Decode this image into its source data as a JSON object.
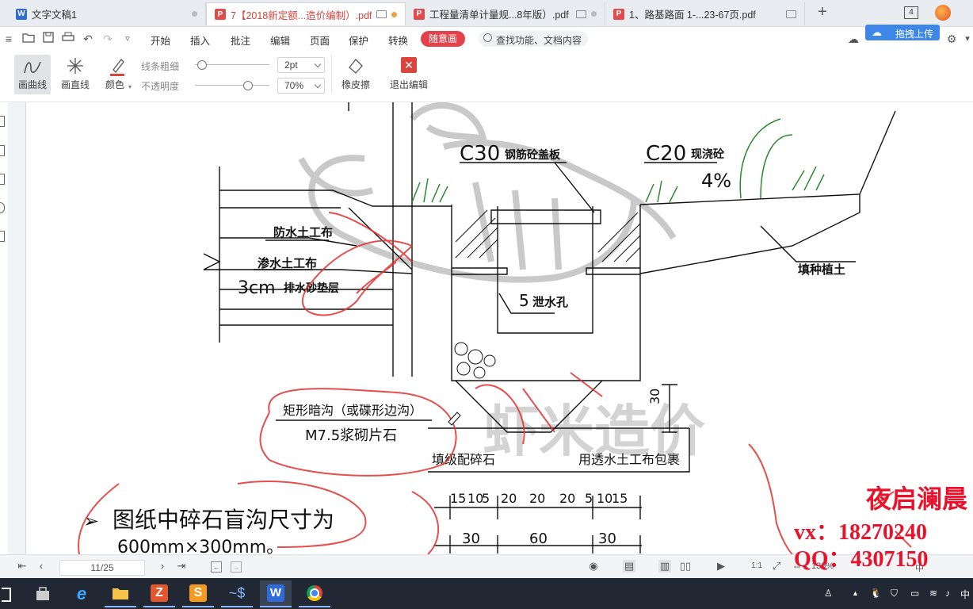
{
  "tabs": [
    {
      "label": "文字文稿1",
      "icon": "word-doc-icon",
      "icon_color": "#2e6bd9",
      "active": false
    },
    {
      "label": "7【2018新定额...造价编制）.pdf",
      "icon": "pdf-icon",
      "icon_color": "#e24b4b",
      "active": true
    },
    {
      "label": "工程量清单计量规...8年版）.pdf",
      "icon": "pdf-icon",
      "icon_color": "#e24b4b",
      "active": false
    },
    {
      "label": "1、路基路面   1-...23-67页.pdf",
      "icon": "pdf-icon",
      "icon_color": "#e24b4b",
      "active": false
    }
  ],
  "window": {
    "count": "4"
  },
  "menubar": {
    "items": [
      "开始",
      "插入",
      "批注",
      "编辑",
      "页面",
      "保护",
      "转换"
    ],
    "active_item": "随意画",
    "search_placeholder": "查找功能、文档内容",
    "cloud_button": "拖拽上传",
    "accent_color": "#e2424b"
  },
  "drawbar": {
    "curve_label": "画曲线",
    "line_label": "画直线",
    "color_label": "颜色",
    "stroke_width_label": "线条粗细",
    "opacity_label": "不透明度",
    "stroke_width_value": "2pt",
    "opacity_value": "70%",
    "opacity_level": 0.7,
    "eraser_label": "橡皮擦",
    "exit_label": "退出编辑"
  },
  "document": {
    "label_c30": "C30",
    "label_c30_sub": "钢筋砼盖板",
    "label_c20": "C20",
    "label_c20_sub": "现浇砼",
    "label_slope": "4%",
    "label_geotextile_waterproof": "防水土工布",
    "label_geotextile_permeable": "渗水土工布",
    "label_sand_layer": "3cm",
    "label_sand_layer_sub": "排水砂垫层",
    "label_drain_hole": "5",
    "label_drain_hole_sub": "泄水孔",
    "label_planting_soil": "填种植土",
    "label_ditch_line1": "矩形暗沟（或碟形边沟）",
    "label_ditch_line2": "M7.5浆砌片石",
    "label_graded_gravel": "填级配碎石",
    "label_wrap": "用透水土工布包裹",
    "dim_height": "30",
    "dim_top": [
      "15",
      "10",
      "5",
      "20",
      "20",
      "20",
      "5",
      "10",
      "15"
    ],
    "dim_bottom": [
      "30",
      "60",
      "30"
    ],
    "note_bullet": "➢",
    "note_line1": "图纸中碎石盲沟尺寸为",
    "note_line2": "600mm×300mm。",
    "watermark": "虾米造价",
    "overlay_name": "夜启澜晨",
    "overlay_vx": "vx：18270240",
    "overlay_qq": "QQ：4307150",
    "overlay_color": "#e8122b"
  },
  "statusbar": {
    "page_indicator": "11/25",
    "zoom_level": "130%",
    "ime_label": "中"
  },
  "taskbar": {
    "apps": [
      "store-icon",
      "ie-icon",
      "file-explorer-icon",
      "wps-z-icon",
      "wps-s-icon",
      "network-tool-icon",
      "wps-w-icon",
      "chrome-icon"
    ],
    "tray_icons": [
      "person-icon",
      "tray-up-icon",
      "qq-icon",
      "shield-icon",
      "battery-icon",
      "wifi-icon",
      "volume-icon"
    ],
    "ime_tray": "中"
  }
}
